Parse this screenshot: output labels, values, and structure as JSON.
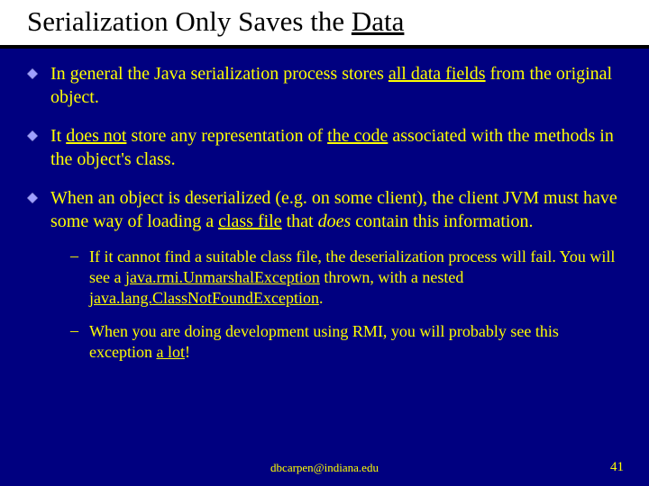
{
  "title": {
    "prefix": "Serialization Only Saves the ",
    "underlined": "Data"
  },
  "bullets": [
    {
      "segments": [
        {
          "t": "In general the Java serialization process stores "
        },
        {
          "t": "all data fields",
          "u": true
        },
        {
          "t": " from the original object."
        }
      ]
    },
    {
      "segments": [
        {
          "t": "It "
        },
        {
          "t": "does not",
          "u": true
        },
        {
          "t": " store any representation of "
        },
        {
          "t": "the code",
          "u": true
        },
        {
          "t": " associated with the methods in the object's class."
        }
      ]
    },
    {
      "segments": [
        {
          "t": "When an object is deserialized (e.g. on some client), the client JVM must have some way of loading a "
        },
        {
          "t": "class file",
          "u": true
        },
        {
          "t": " that "
        },
        {
          "t": "does",
          "i": true
        },
        {
          "t": " contain this information."
        }
      ]
    }
  ],
  "subbullets": [
    {
      "segments": [
        {
          "t": "If it cannot find a suitable class file, the deserialization process will fail.  You will see a "
        },
        {
          "t": "java.rmi.UnmarshalException",
          "u": true
        },
        {
          "t": " thrown, with a nested "
        },
        {
          "t": "java.lang.ClassNotFoundException",
          "u": true
        },
        {
          "t": "."
        }
      ]
    },
    {
      "segments": [
        {
          "t": "When you are doing development using RMI, you will probably see this exception "
        },
        {
          "t": "a lot",
          "u": true
        },
        {
          "t": "!"
        }
      ]
    }
  ],
  "footer": "dbcarpen@indiana.edu",
  "pagenum": "41"
}
